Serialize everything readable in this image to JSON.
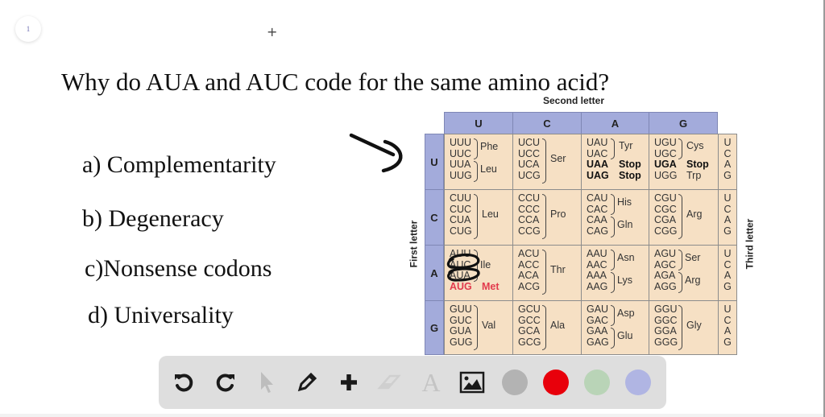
{
  "page_indicator": "1",
  "question": "Why do AUA and AUC code for the same amino acid?",
  "options": [
    {
      "label": "a) Complementarity"
    },
    {
      "label": "b) Degeneracy"
    },
    {
      "label": "c)Nonsense codons"
    },
    {
      "label": "d) Universality"
    }
  ],
  "codon_table": {
    "second_letter_label": "Second letter",
    "first_letter_label": "First letter",
    "third_letter_label": "Third letter",
    "columns": [
      "U",
      "C",
      "A",
      "G"
    ],
    "rows": [
      "U",
      "C",
      "A",
      "G"
    ],
    "third_letters": [
      "U",
      "C",
      "A",
      "G"
    ],
    "cells": {
      "U": {
        "U": {
          "codons": [
            "UUU",
            "UUC",
            "UUA",
            "UUG"
          ],
          "aa": [
            "Phe",
            "Leu"
          ]
        },
        "C": {
          "codons": [
            "UCU",
            "UCC",
            "UCA",
            "UCG"
          ],
          "aa": [
            "Ser"
          ]
        },
        "A": {
          "codons": [
            "UAU",
            "UAC",
            "UAA",
            "UAG"
          ],
          "aa": [
            "Tyr",
            "Stop",
            "Stop"
          ]
        },
        "G": {
          "codons": [
            "UGU",
            "UGC",
            "UGA",
            "UGG"
          ],
          "aa": [
            "Cys",
            "Stop",
            "Trp"
          ]
        }
      },
      "C": {
        "U": {
          "codons": [
            "CUU",
            "CUC",
            "CUA",
            "CUG"
          ],
          "aa": [
            "Leu"
          ]
        },
        "C": {
          "codons": [
            "CCU",
            "CCC",
            "CCA",
            "CCG"
          ],
          "aa": [
            "Pro"
          ]
        },
        "A": {
          "codons": [
            "CAU",
            "CAC",
            "CAA",
            "CAG"
          ],
          "aa": [
            "His",
            "Gln"
          ]
        },
        "G": {
          "codons": [
            "CGU",
            "CGC",
            "CGA",
            "CGG"
          ],
          "aa": [
            "Arg"
          ]
        }
      },
      "A": {
        "U": {
          "codons": [
            "AUU",
            "AUC",
            "AUA",
            "AUG"
          ],
          "aa": [
            "Ile",
            "Met"
          ]
        },
        "C": {
          "codons": [
            "ACU",
            "ACC",
            "ACA",
            "ACG"
          ],
          "aa": [
            "Thr"
          ]
        },
        "A": {
          "codons": [
            "AAU",
            "AAC",
            "AAA",
            "AAG"
          ],
          "aa": [
            "Asn",
            "Lys"
          ]
        },
        "G": {
          "codons": [
            "AGU",
            "AGC",
            "AGA",
            "AGG"
          ],
          "aa": [
            "Ser",
            "Arg"
          ]
        }
      },
      "G": {
        "U": {
          "codons": [
            "GUU",
            "GUC",
            "GUA",
            "GUG"
          ],
          "aa": [
            "Val"
          ]
        },
        "C": {
          "codons": [
            "GCU",
            "GCC",
            "GCA",
            "GCG"
          ],
          "aa": [
            "Ala"
          ]
        },
        "A": {
          "codons": [
            "GAU",
            "GAC",
            "GAA",
            "GAG"
          ],
          "aa": [
            "Asp",
            "Glu"
          ]
        },
        "G": {
          "codons": [
            "GGU",
            "GGC",
            "GGA",
            "GGG"
          ],
          "aa": [
            "Gly"
          ]
        }
      }
    }
  },
  "toolbar": {
    "tools": [
      {
        "name": "undo-button",
        "icon": "undo-icon",
        "enabled": true
      },
      {
        "name": "redo-button",
        "icon": "redo-icon",
        "enabled": true
      },
      {
        "name": "select-button",
        "icon": "pointer-icon",
        "enabled": false
      },
      {
        "name": "pen-button",
        "icon": "pencil-icon",
        "enabled": true
      },
      {
        "name": "add-button",
        "icon": "plus-icon",
        "enabled": true
      },
      {
        "name": "eraser-button",
        "icon": "eraser-icon",
        "enabled": false
      },
      {
        "name": "text-button",
        "icon": "text-icon",
        "enabled": false,
        "glyph": "A"
      },
      {
        "name": "image-button",
        "icon": "image-icon",
        "enabled": true
      }
    ],
    "colors": [
      {
        "name": "gray",
        "hex": "#b3b3b3"
      },
      {
        "name": "red",
        "hex": "#e8000b"
      },
      {
        "name": "green",
        "hex": "#b9d4b7"
      },
      {
        "name": "blue",
        "hex": "#b0b5e3"
      }
    ]
  }
}
